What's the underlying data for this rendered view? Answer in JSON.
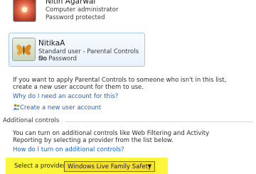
{
  "accounts": [
    {
      "name": "Nitin Agarwal",
      "role": "Computer administrator",
      "password": "Password protected",
      "icon": "user-picture-flower-icon"
    },
    {
      "name": "NitikaA",
      "role": "Standard user - Parental Controls On",
      "password": "No Password",
      "icon": "user-picture-butterfly-icon",
      "selected": true
    }
  ],
  "info_text_line1": "If you want to apply Parental Controls to someone who isn't in this list,",
  "info_text_line2": "create a new user account for them to use.",
  "why_link": "Why do I need an account for this?",
  "create_account_link": "Create a new user account",
  "additional_controls": {
    "heading": "Additional controls",
    "text_line1": "You can turn on additional controls like Web Filtering and Activity",
    "text_line2": "Reporting by selecting a provider from the list below.",
    "how_link": "How do I turn on additional controls?",
    "provider_label": "Select a provider:",
    "provider_value": "Windows Live Family Safety"
  },
  "colors": {
    "link": "#1a64c8",
    "highlight": "#fbf63a",
    "selected_border": "#a8c8ea"
  }
}
